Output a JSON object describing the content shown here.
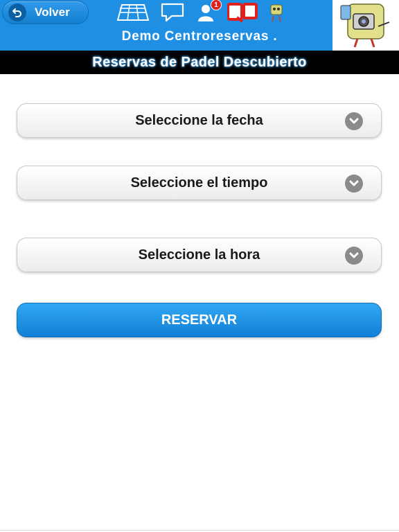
{
  "header": {
    "back_label": "Volver",
    "site_title": "Demo Centroreservas .",
    "notification_count": "1",
    "icons": [
      "court-icon",
      "chat-icon",
      "notifications-icon",
      "app-logo-icon",
      "mascot-icon"
    ],
    "brand_color": "#1e8fe3"
  },
  "subtitle": "Reservas de Padel Descubierto",
  "form": {
    "date_select": "Seleccione la fecha",
    "time_select": "Seleccione el tiempo",
    "hour_select": "Seleccione la hora",
    "submit_label": "RESERVAR",
    "accent_color": "#1b8fe6"
  }
}
